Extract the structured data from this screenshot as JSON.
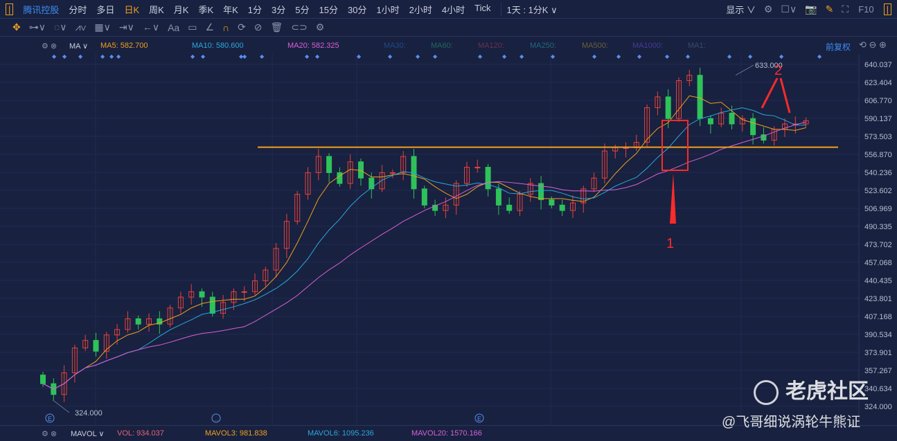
{
  "toolbar": {
    "stock": "腾讯控股",
    "periods": [
      "分时",
      "多日",
      "日K",
      "周K",
      "月K",
      "季K",
      "年K",
      "1分",
      "3分",
      "5分",
      "15分",
      "30分",
      "1小时",
      "2小时",
      "4小时",
      "Tick"
    ],
    "active": "日K",
    "range": "1天 : 1分K ∨",
    "display": "显示 ∨",
    "f10": "F10",
    "adjust": "前复权"
  },
  "ma_legend": {
    "type": "MA ∨",
    "ma5": "MA5: 582.700",
    "ma10": "MA10: 580.600",
    "ma20": "MA20: 582.325",
    "ma30": "MA30:",
    "ma60": "MA60:",
    "ma120": "MA120:",
    "ma250": "MA250:",
    "ma500": "MA500:",
    "ma1000": "MA1000:",
    "ma1": "MA1:"
  },
  "vol_legend": {
    "type": "MAVOL ∨",
    "vol": "VOL: 934.037",
    "mavol3": "MAVOL3: 981.838",
    "mavol6": "MAVOL6: 1095.236",
    "mavol20": "MAVOL20: 1570.166"
  },
  "colors": {
    "up": "#e8423f",
    "down": "#2fc25b",
    "ma5": "#f0a020",
    "ma10": "#2aa8e0",
    "ma20": "#d860d8",
    "support": "#f0a020",
    "annot": "#ff2a2a"
  },
  "chart_data": {
    "type": "candlestick",
    "ylim": [
      324.0,
      640.037
    ],
    "yticks": [
      "640.037",
      "623.404",
      "606.770",
      "590.137",
      "573.503",
      "556.870",
      "540.236",
      "523.602",
      "506.969",
      "490.335",
      "473.702",
      "457.068",
      "440.435",
      "423.801",
      "407.168",
      "390.534",
      "373.901",
      "357.267",
      "340.634",
      "324.000"
    ],
    "close": [
      345,
      335,
      355,
      378,
      385,
      375,
      390,
      395,
      405,
      400,
      405,
      400,
      415,
      425,
      430,
      425,
      410,
      420,
      430,
      430,
      440,
      450,
      470,
      495,
      520,
      540,
      555,
      540,
      530,
      550,
      535,
      525,
      540,
      540,
      555,
      525,
      510,
      505,
      510,
      530,
      545,
      545,
      525,
      510,
      505,
      520,
      530,
      515,
      510,
      505,
      512,
      525,
      535,
      560,
      563,
      563,
      568,
      600,
      610,
      590,
      625,
      630,
      590,
      585,
      595,
      585,
      590,
      575,
      570,
      580,
      585,
      585,
      588
    ],
    "max_label": "633.000",
    "min_label": "324.000",
    "support_level": 563.5,
    "annotations": [
      "1",
      "2"
    ]
  },
  "watermark": {
    "logo": "老虎社区",
    "author": "@飞哥细说涡轮牛熊证"
  }
}
